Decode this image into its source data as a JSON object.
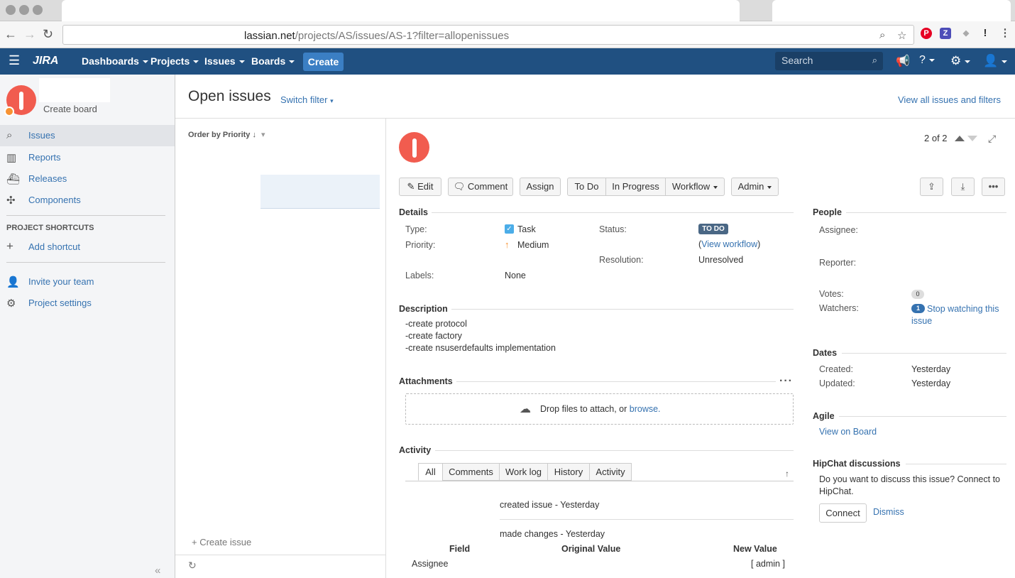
{
  "browser": {
    "url_host": "lassian.net",
    "url_path": "/projects/AS/issues/AS-1?filter=allopenissues"
  },
  "header": {
    "logo": "JIRA",
    "nav": [
      "Dashboards",
      "Projects",
      "Issues",
      "Boards"
    ],
    "create_label": "Create",
    "search_placeholder": "Search"
  },
  "sidebar": {
    "create_board": "Create board",
    "items": [
      {
        "label": "Issues",
        "icon": "issues-icon"
      },
      {
        "label": "Reports",
        "icon": "reports-icon"
      },
      {
        "label": "Releases",
        "icon": "releases-icon"
      },
      {
        "label": "Components",
        "icon": "components-icon"
      }
    ],
    "shortcuts_heading": "PROJECT SHORTCUTS",
    "add_shortcut": "Add shortcut",
    "invite": "Invite your team",
    "settings": "Project settings"
  },
  "main": {
    "title": "Open issues",
    "switch_filter": "Switch filter",
    "view_all": "View all issues and filters",
    "order_by": "Order by Priority",
    "create_issue": "+ Create issue"
  },
  "issue": {
    "pager": "2 of 2",
    "buttons": {
      "edit": "Edit",
      "comment": "Comment",
      "assign": "Assign",
      "todo": "To Do",
      "in_progress": "In Progress",
      "workflow": "Workflow",
      "admin": "Admin"
    },
    "details": {
      "heading": "Details",
      "type_label": "Type:",
      "type_value": "Task",
      "priority_label": "Priority:",
      "priority_value": "Medium",
      "labels_label": "Labels:",
      "labels_value": "None",
      "status_label": "Status:",
      "status_value": "TO DO",
      "view_workflow": "View workflow",
      "resolution_label": "Resolution:",
      "resolution_value": "Unresolved"
    },
    "description": {
      "heading": "Description",
      "lines": [
        "-create protocol",
        "-create factory",
        "-create nsuserdefaults implementation"
      ]
    },
    "attachments": {
      "heading": "Attachments",
      "drop_text": "Drop files to attach, or",
      "browse": "browse."
    },
    "activity": {
      "heading": "Activity",
      "tabs": [
        "All",
        "Comments",
        "Work log",
        "History",
        "Activity"
      ],
      "entry1": "created issue - Yesterday",
      "entry2": "made changes - Yesterday",
      "col_field": "Field",
      "col_original": "Original Value",
      "col_new": "New Value",
      "row_field": "Assignee",
      "row_new": "[ admin ]"
    },
    "people": {
      "heading": "People",
      "assignee_label": "Assignee:",
      "reporter_label": "Reporter:",
      "votes_label": "Votes:",
      "votes_count": "0",
      "watchers_label": "Watchers:",
      "watchers_count": "1",
      "stop_watching": "Stop watching this issue"
    },
    "dates": {
      "heading": "Dates",
      "created_label": "Created:",
      "created_value": "Yesterday",
      "updated_label": "Updated:",
      "updated_value": "Yesterday"
    },
    "agile": {
      "heading": "Agile",
      "view_on_board": "View on Board"
    },
    "hipchat": {
      "heading": "HipChat discussions",
      "text": "Do you want to discuss this issue? Connect to HipChat.",
      "connect": "Connect",
      "dismiss": "Dismiss"
    }
  },
  "colors": {
    "header_bg": "#205081",
    "link": "#3572b0",
    "todo_badge": "#4a6785",
    "avatar": "#f15c4f"
  }
}
